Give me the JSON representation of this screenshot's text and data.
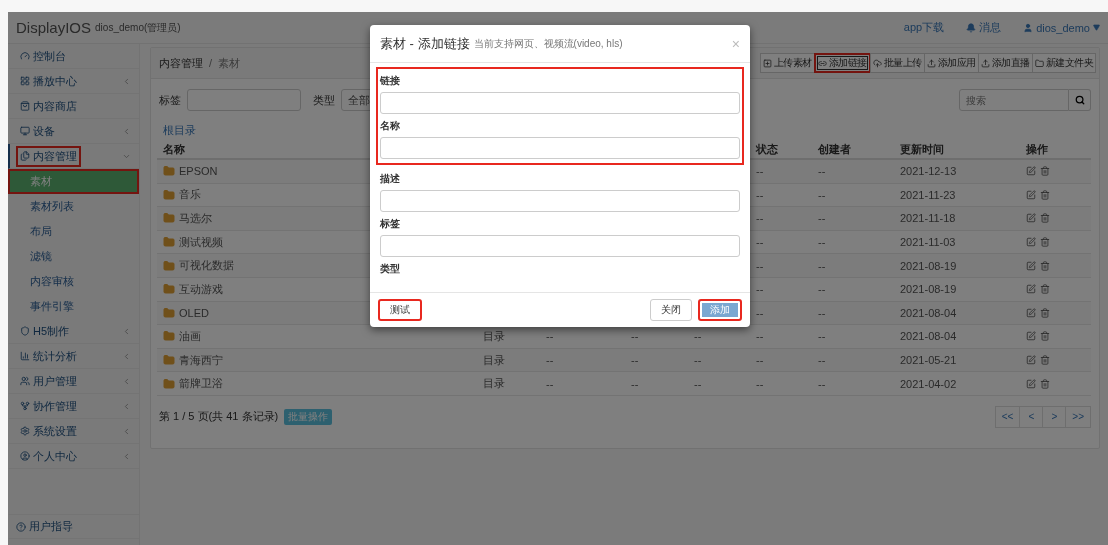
{
  "topbar": {
    "brand": "DisplayIOS",
    "user_role": "dios_demo(管理员)",
    "links": [
      {
        "label": "app下载"
      },
      {
        "label": "消息"
      },
      {
        "label": "dios_demo"
      }
    ]
  },
  "sidebar": {
    "items": [
      {
        "label": "控制台",
        "has_children": false,
        "expanded": false,
        "highlighted": false
      },
      {
        "label": "播放中心",
        "has_children": true,
        "expanded": false,
        "highlighted": false
      },
      {
        "label": "内容商店",
        "has_children": false,
        "expanded": false,
        "highlighted": false
      },
      {
        "label": "设备",
        "has_children": true,
        "expanded": false,
        "highlighted": false
      },
      {
        "label": "内容管理",
        "has_children": true,
        "expanded": true,
        "highlighted": true,
        "children": [
          {
            "label": "素材",
            "selected": true,
            "highlighted": true
          },
          {
            "label": "素材列表",
            "selected": false,
            "highlighted": false
          },
          {
            "label": "布局",
            "selected": false,
            "highlighted": false
          },
          {
            "label": "滤镜",
            "selected": false,
            "highlighted": false
          },
          {
            "label": "内容审核",
            "selected": false,
            "highlighted": false
          },
          {
            "label": "事件引擎",
            "selected": false,
            "highlighted": false
          }
        ]
      },
      {
        "label": "H5制作",
        "has_children": true,
        "expanded": false,
        "highlighted": false
      },
      {
        "label": "统计分析",
        "has_children": true,
        "expanded": false,
        "highlighted": false
      },
      {
        "label": "用户管理",
        "has_children": true,
        "expanded": false,
        "highlighted": false
      },
      {
        "label": "协作管理",
        "has_children": true,
        "expanded": false,
        "highlighted": false
      },
      {
        "label": "系统设置",
        "has_children": true,
        "expanded": false,
        "highlighted": false
      },
      {
        "label": "个人中心",
        "has_children": true,
        "expanded": false,
        "highlighted": false
      }
    ],
    "footer": {
      "label": "用户指导"
    }
  },
  "breadcrumb": {
    "items": [
      "内容管理",
      "素材"
    ],
    "separator": "/"
  },
  "toolbar": [
    {
      "label": "上传素材",
      "highlighted": false
    },
    {
      "label": "添加链接",
      "highlighted": true
    },
    {
      "label": "批量上传",
      "highlighted": false
    },
    {
      "label": "添加应用",
      "highlighted": false
    },
    {
      "label": "添加直播",
      "highlighted": false
    },
    {
      "label": "新建文件夹",
      "highlighted": false
    }
  ],
  "filters": {
    "tag_label": "标签",
    "type_label": "类型",
    "type_value": "全部",
    "search_placeholder": "搜索"
  },
  "root_link": "根目录",
  "table": {
    "columns": [
      "名称",
      "",
      "",
      "",
      "",
      "状态",
      "创建者",
      "更新时间",
      "操作"
    ],
    "rows": [
      {
        "cells": [
          "EPSON",
          "",
          "",
          "",
          "",
          "--",
          "--",
          "2021-12-13"
        ]
      },
      {
        "cells": [
          "音乐",
          "",
          "",
          "",
          "",
          "--",
          "--",
          "2021-11-23"
        ]
      },
      {
        "cells": [
          "马选尔",
          "",
          "",
          "",
          "",
          "--",
          "--",
          "2021-11-18"
        ]
      },
      {
        "cells": [
          "测试视频",
          "",
          "",
          "",
          "",
          "--",
          "--",
          "2021-11-03"
        ]
      },
      {
        "cells": [
          "可视化数据",
          "",
          "",
          "",
          "",
          "--",
          "--",
          "2021-08-19"
        ]
      },
      {
        "cells": [
          "互动游戏",
          "",
          "",
          "",
          "",
          "--",
          "--",
          "2021-08-19"
        ]
      },
      {
        "cells": [
          "OLED",
          "",
          "",
          "",
          "",
          "--",
          "--",
          "2021-08-04"
        ]
      },
      {
        "cells": [
          "油画",
          "目录",
          "--",
          "--",
          "--",
          "--",
          "--",
          "2021-08-04"
        ]
      },
      {
        "cells": [
          "青海西宁",
          "目录",
          "--",
          "--",
          "--",
          "--",
          "--",
          "2021-05-21"
        ]
      },
      {
        "cells": [
          "箭牌卫浴",
          "目录",
          "--",
          "--",
          "--",
          "--",
          "--",
          "2021-04-02"
        ]
      }
    ]
  },
  "pagination": {
    "summary": "第 1 / 5 页(共 41 条记录)",
    "batch_button": "批量操作",
    "pages": [
      "<<",
      "<",
      ">",
      ">>"
    ]
  },
  "modal": {
    "title": "素材 - 添加链接",
    "subtitle": "当前支持网页、视频流(video, hls)",
    "close": "×",
    "fields": [
      {
        "kind": "input",
        "label": "链接",
        "highlighted": true
      },
      {
        "kind": "input",
        "label": "名称",
        "highlighted": true
      },
      {
        "kind": "input",
        "label": "描述",
        "highlighted": false
      },
      {
        "kind": "input",
        "label": "标签",
        "highlighted": false
      },
      {
        "kind": "label",
        "label": "类型",
        "highlighted": false
      }
    ],
    "buttons": [
      {
        "kind": "default",
        "label": "测试",
        "highlighted": true
      },
      {
        "kind": "default",
        "label": "关闭",
        "highlighted": false
      },
      {
        "kind": "primary",
        "label": "添加",
        "highlighted": true
      }
    ]
  }
}
